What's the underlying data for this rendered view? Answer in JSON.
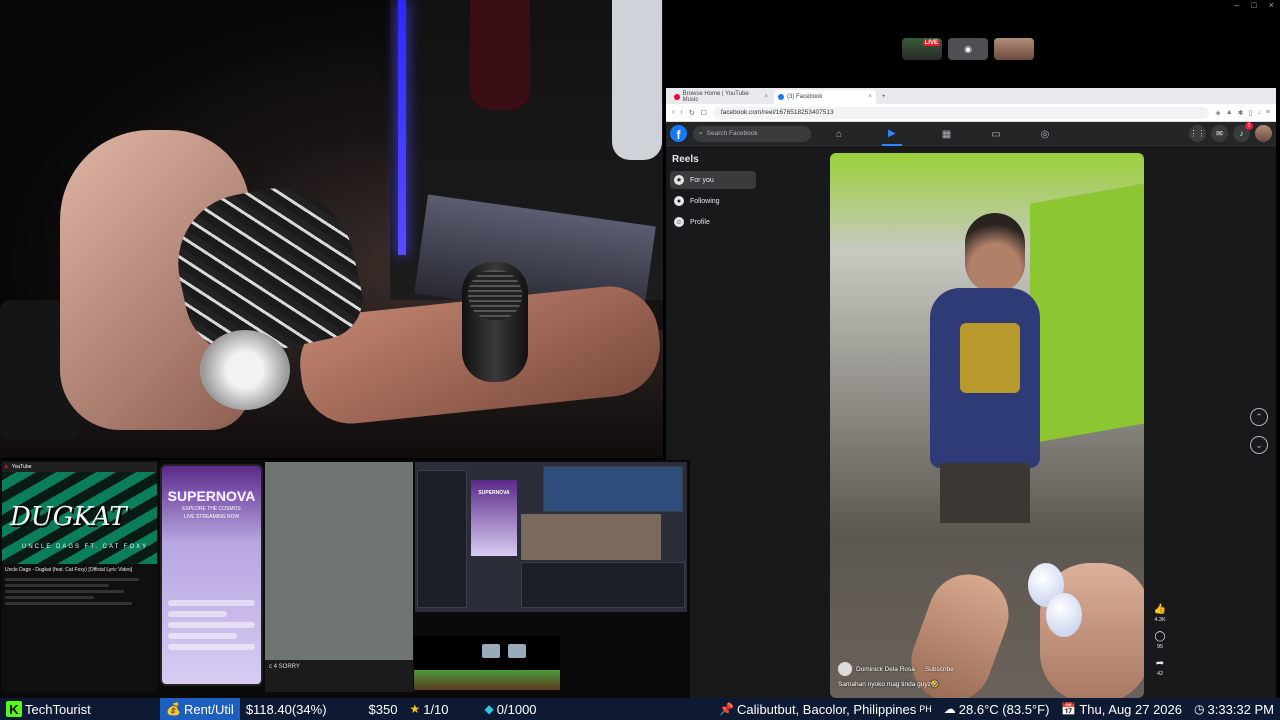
{
  "window_controls": [
    "–",
    "□",
    "×"
  ],
  "discord": {
    "live_badge": "LIVE",
    "tiles": [
      {
        "icon": "stream-thumbnail",
        "label": ""
      },
      {
        "icon": "discord-icon",
        "label": "◉"
      },
      {
        "icon": "user-avatar",
        "label": ""
      }
    ]
  },
  "browser": {
    "tabs": [
      {
        "label": "Browse Home | YouTube Music",
        "color": "#ff0033"
      },
      {
        "label": "(3) Facebook",
        "color": "#1877f2"
      }
    ],
    "url": "facebook.com/reel/1676518253407513",
    "search_placeholder": "Search Facebook",
    "notification_count": "3"
  },
  "reels": {
    "title": "Reels",
    "menu": [
      {
        "label": "For you",
        "icon": "star-icon",
        "active": true
      },
      {
        "label": "Following",
        "icon": "following-icon",
        "active": false
      },
      {
        "label": "Profile",
        "icon": "profile-icon",
        "active": false
      }
    ],
    "author": "Dominick Dela Rosa",
    "subscribe": "Subscribe",
    "caption": "Samahan nyoko mag tinda guyz🤣",
    "actions": [
      {
        "icon": "like-icon",
        "count": "4.3K"
      },
      {
        "icon": "comment-icon",
        "count": "95"
      },
      {
        "icon": "share-icon",
        "count": "42"
      }
    ]
  },
  "previews": {
    "youtube": {
      "big_text": "DUGKAT",
      "small_text": "UNCLE DAGS   FT. CAT FOXY",
      "video_title": "Uncle Dags - Dugkat (feat. Cat Foxy) [Official Lyric Video]"
    },
    "supernova": {
      "title": "SUPERNOVA",
      "subtitle": "EXPLORE THE COSMOS",
      "tagline": "LIVE STREAMING NOW"
    },
    "terminal_text": "c 4  SORRY"
  },
  "status_bar": {
    "username": "TechTourist",
    "rent_label": "Rent/Util",
    "rent_value": "$118.40(34%)",
    "goal": "$350",
    "stars": "1/10",
    "gems": "0/1000",
    "location": "Calibutbut, Bacolor, Philippines",
    "country_code": "PH",
    "weather": "28.6°C (83.5°F)",
    "date": "Thu, Aug 27 2026",
    "time": "3:33:32 PM"
  }
}
